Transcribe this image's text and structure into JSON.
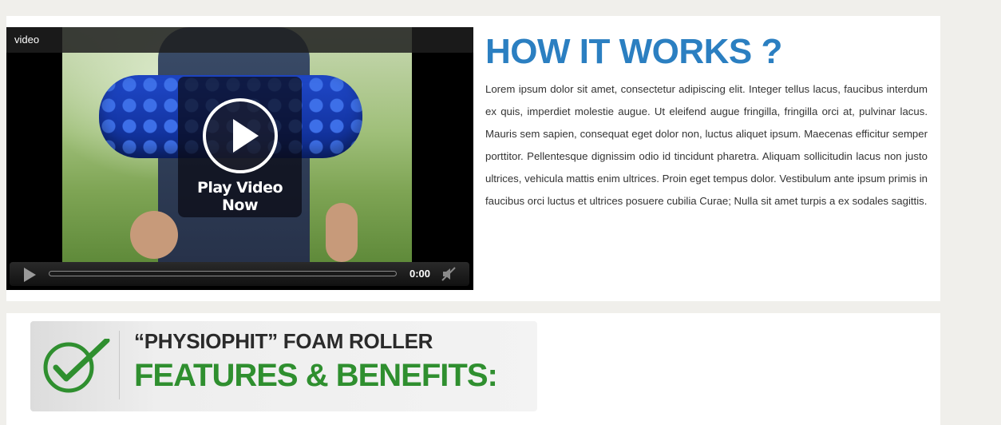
{
  "video": {
    "title": "video",
    "overlay_label": "Play Video Now",
    "time": "0:00"
  },
  "section": {
    "heading": "HOW IT WORKS ?",
    "body": "Lorem ipsum dolor sit amet, consectetur adipiscing elit. Integer tellus lacus, faucibus interdum ex quis, imperdiet molestie augue. Ut eleifend augue fringilla, fringilla orci at, pulvinar lacus. Mauris sem sapien, consequat eget dolor non, luctus aliquet ipsum. Maecenas efficitur semper porttitor. Pellentesque dignissim odio id tincidunt pharetra. Aliquam sollicitudin lacus non justo ultrices, vehicula mattis enim ultrices. Proin eget tempus dolor. Vestibulum ante ipsum primis in faucibus orci luctus et ultrices posuere cubilia Curae; Nulla sit amet turpis a ex sodales sagittis."
  },
  "banner": {
    "line1": "“PHYSIOPHIT” FOAM ROLLER",
    "line2": "FEATURES & BENEFITS:"
  },
  "colors": {
    "heading": "#2b7fc1",
    "accent_green": "#2f8f2f",
    "page_background": "#f0efeb"
  },
  "icons": {
    "play": "play-icon",
    "mute": "mute-icon",
    "check": "checkmark-icon"
  }
}
